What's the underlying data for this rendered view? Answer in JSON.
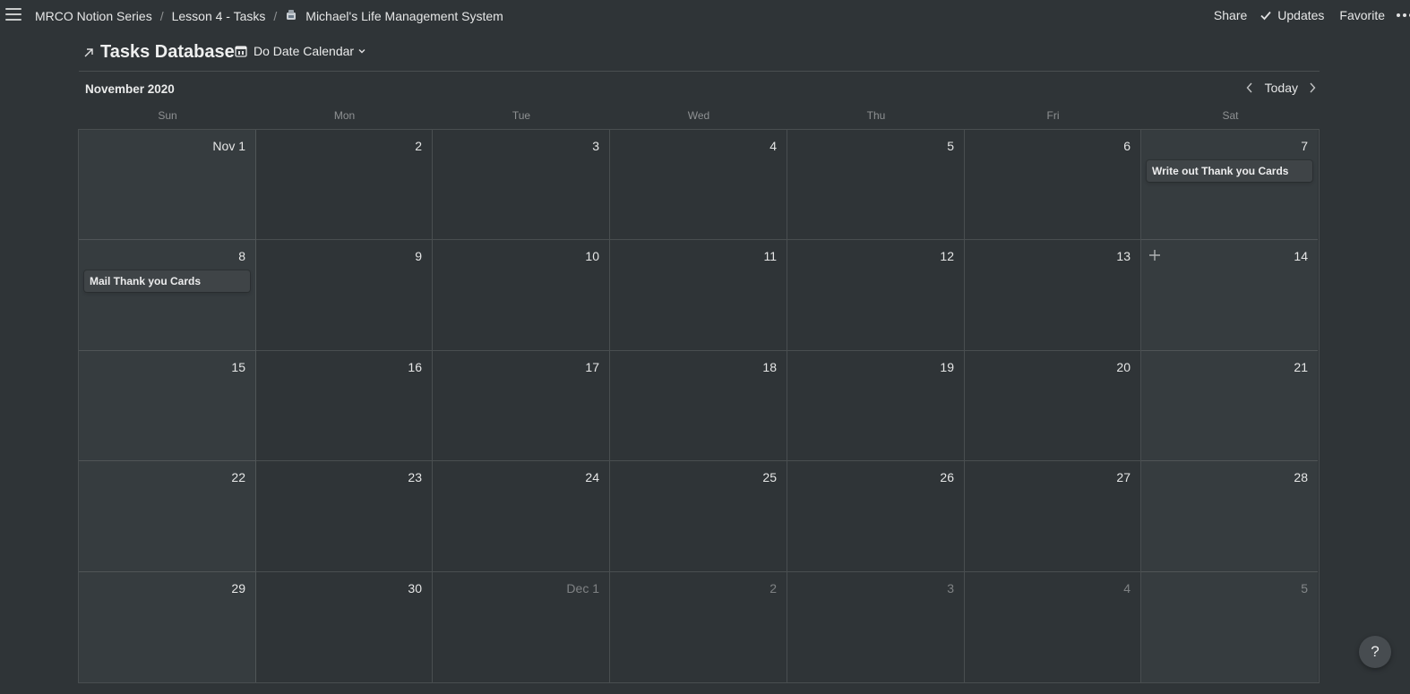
{
  "topbar": {
    "breadcrumb": [
      {
        "label": "MRCO Notion Series"
      },
      {
        "label": "Lesson 4 - Tasks"
      },
      {
        "label": "Michael's Life Management System",
        "icon": "page-emoji-icon"
      }
    ],
    "share_label": "Share",
    "updates_label": "Updates",
    "favorite_label": "Favorite"
  },
  "database": {
    "title": "Tasks Database",
    "view_name": "Do Date Calendar"
  },
  "calendar": {
    "month_label": "November 2020",
    "today_label": "Today",
    "weekdays": [
      "Sun",
      "Mon",
      "Tue",
      "Wed",
      "Thu",
      "Fri",
      "Sat"
    ],
    "days": [
      {
        "label": "Nov 1"
      },
      {
        "label": "2"
      },
      {
        "label": "3"
      },
      {
        "label": "4"
      },
      {
        "label": "5"
      },
      {
        "label": "6"
      },
      {
        "label": "7",
        "task": "Write out Thank you Cards"
      },
      {
        "label": "8",
        "task": "Mail Thank you Cards"
      },
      {
        "label": "9"
      },
      {
        "label": "10"
      },
      {
        "label": "11"
      },
      {
        "label": "12"
      },
      {
        "label": "13"
      },
      {
        "label": "14",
        "add_button": true
      },
      {
        "label": "15"
      },
      {
        "label": "16"
      },
      {
        "label": "17"
      },
      {
        "label": "18"
      },
      {
        "label": "19"
      },
      {
        "label": "20"
      },
      {
        "label": "21"
      },
      {
        "label": "22"
      },
      {
        "label": "23"
      },
      {
        "label": "24"
      },
      {
        "label": "25"
      },
      {
        "label": "26"
      },
      {
        "label": "27"
      },
      {
        "label": "28"
      },
      {
        "label": "29"
      },
      {
        "label": "30"
      },
      {
        "label": "Dec 1",
        "other_month": true
      },
      {
        "label": "2",
        "other_month": true
      },
      {
        "label": "3",
        "other_month": true
      },
      {
        "label": "4",
        "other_month": true
      },
      {
        "label": "5",
        "other_month": true
      }
    ]
  },
  "help_label": "?",
  "colors": {
    "background": "#2f3437",
    "weekend_background": "#363c3f",
    "card_background": "#3f4447"
  }
}
